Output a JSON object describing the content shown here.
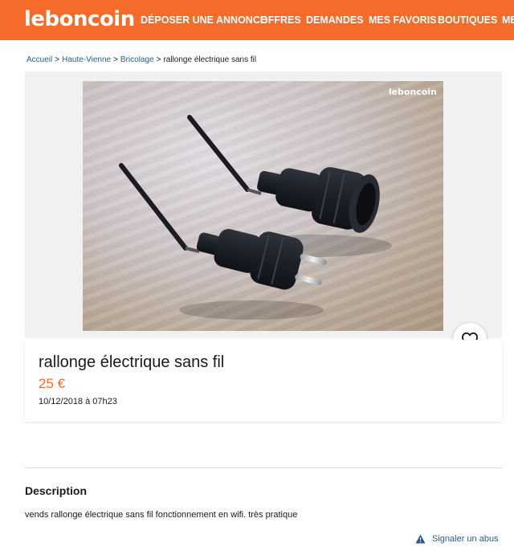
{
  "header": {
    "logo": "leboncoin",
    "nav": [
      "DÉPOSER UNE ANNONCE",
      "OFFRES",
      "DEMANDES",
      "MES FAVORIS",
      "BOUTIQUES",
      "ME"
    ]
  },
  "breadcrumb": {
    "items": [
      "Accueil",
      "Haute-Vienne",
      "Bricolage"
    ],
    "current": "rallonge électrique sans fil",
    "separator": ">"
  },
  "photo": {
    "watermark": "leboncoin"
  },
  "listing": {
    "title": "rallonge électrique sans fil",
    "price": "25 €",
    "date": "10/12/2018 à 07h23"
  },
  "description": {
    "heading": "Description",
    "text": "vends rallonge électrique sans fil fonctionnement en wifi. très pratique"
  },
  "report": {
    "label": "Signaler un abus"
  },
  "colors": {
    "brand": "#f56b2a",
    "link": "#2a5c8a"
  },
  "icons": {
    "favorite": "heart-icon",
    "report": "warning-icon"
  }
}
